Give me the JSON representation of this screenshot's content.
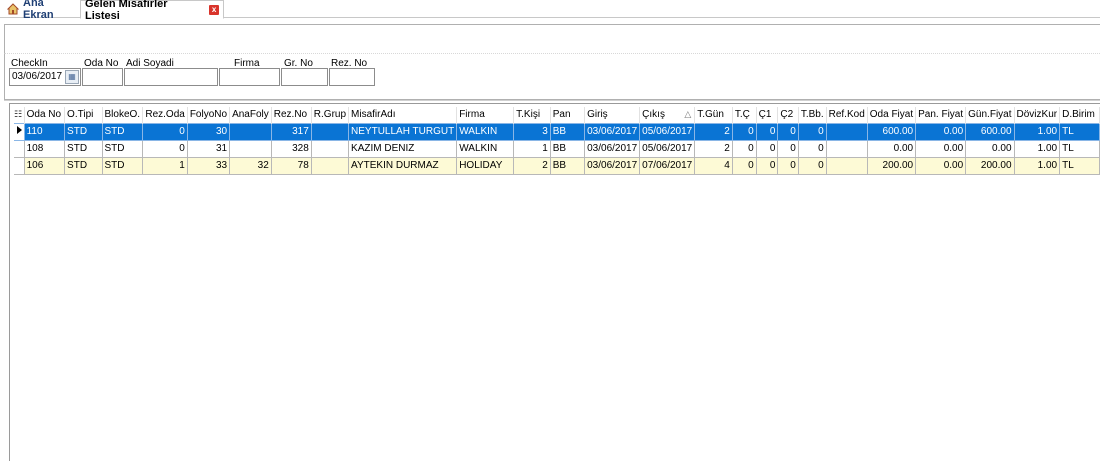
{
  "tabs": {
    "home_label": "Ana Ekran",
    "active_label": "Gelen Misafirler Listesi",
    "close_symbol": "x"
  },
  "filters": {
    "checkin_label": "CheckIn",
    "checkin_value": "03/06/2017",
    "odano_label": "Oda No",
    "adisoyadi_label": "Adi Soyadi",
    "firma_label": "Firma",
    "grno_label": "Gr. No",
    "rezno_label": "Rez. No"
  },
  "grid": {
    "columns": [
      "Oda No",
      "O.Tipi",
      "BlokeO.",
      "Rez.Oda",
      "FolyoNo",
      "AnaFoly",
      "Rez.No",
      "R.Grup",
      "MisafirAdı",
      "Firma",
      "T.Kişi",
      "Pan",
      "Giriş",
      "Çıkış",
      "T.Gün",
      "T.Ç",
      "Ç1",
      "Ç2",
      "T.Bb.",
      "Ref.Kod",
      "Oda Fiyat",
      "Pan. Fiyat",
      "Gün.Fiyat",
      "DövizKur",
      "D.Birim"
    ],
    "rows": [
      [
        "110",
        "STD",
        "STD",
        "0",
        "30",
        "",
        "317",
        "",
        "NEYTULLAH TURGUT",
        "WALKIN",
        "3",
        "BB",
        "03/06/2017",
        "05/06/2017",
        "2",
        "0",
        "0",
        "0",
        "0",
        "",
        "600.00",
        "0.00",
        "600.00",
        "1.00",
        "TL"
      ],
      [
        "108",
        "STD",
        "STD",
        "0",
        "31",
        "",
        "328",
        "",
        "KAZIM DENIZ",
        "WALKIN",
        "1",
        "BB",
        "03/06/2017",
        "05/06/2017",
        "2",
        "0",
        "0",
        "0",
        "0",
        "",
        "0.00",
        "0.00",
        "0.00",
        "1.00",
        "TL"
      ],
      [
        "106",
        "STD",
        "STD",
        "1",
        "33",
        "32",
        "78",
        "",
        "AYTEKIN DURMAZ",
        "HOLIDAY",
        "2",
        "BB",
        "03/06/2017",
        "07/06/2017",
        "4",
        "0",
        "0",
        "0",
        "0",
        "",
        "200.00",
        "0.00",
        "200.00",
        "1.00",
        "TL"
      ]
    ],
    "sorted_column": "Çıkış"
  }
}
